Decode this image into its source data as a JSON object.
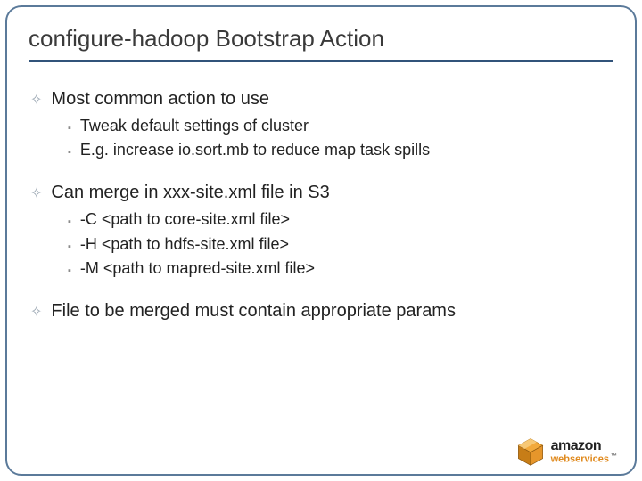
{
  "title": "configure-hadoop Bootstrap Action",
  "items": [
    {
      "text": "Most common action to use",
      "children": [
        {
          "text": "Tweak default settings of cluster"
        },
        {
          "text": "E.g. increase io.sort.mb to reduce map task spills"
        }
      ]
    },
    {
      "text": "Can merge in xxx-site.xml file in S3",
      "children": [
        {
          "text": "-C <path to core-site.xml file>"
        },
        {
          "text": "-H <path to hdfs-site.xml file>"
        },
        {
          "text": "-M <path to mapred-site.xml file>"
        }
      ]
    },
    {
      "text": "File to be merged must contain appropriate params",
      "children": []
    }
  ],
  "logo": {
    "brand": "amazon",
    "sub": "webservices"
  }
}
